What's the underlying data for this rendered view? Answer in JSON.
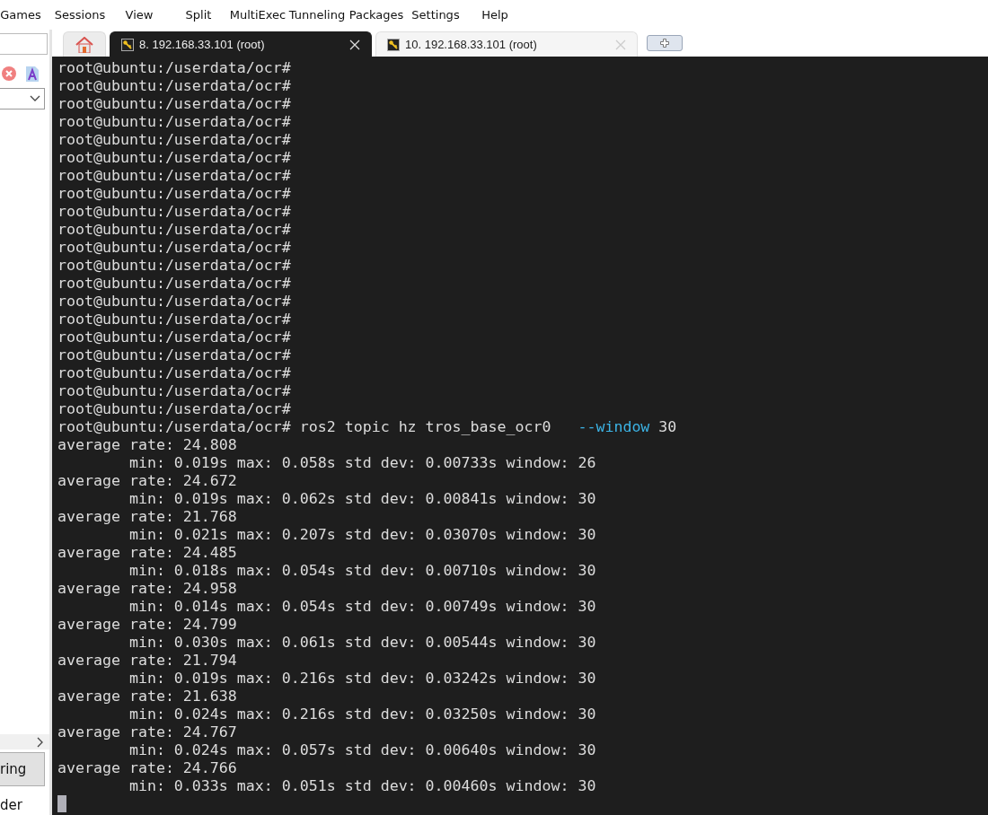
{
  "menu": [
    "Games",
    "Sessions",
    "View",
    "Split",
    "MultiExec",
    "Tunneling",
    "Packages",
    "Settings",
    "Help"
  ],
  "sidebar": {
    "button": "ring",
    "text": "der"
  },
  "tabs": [
    {
      "kind": "home",
      "selected": false
    },
    {
      "kind": "session",
      "label": "8. 192.168.33.101 (root)",
      "selected": true
    },
    {
      "kind": "session",
      "label": "10. 192.168.33.101 (root)",
      "selected": false
    },
    {
      "kind": "new",
      "selected": false
    }
  ],
  "terminal": {
    "lines": [
      {
        "kind": "prompt",
        "text": "root@ubuntu:/userdata/ocr#"
      },
      {
        "kind": "prompt",
        "text": "root@ubuntu:/userdata/ocr#"
      },
      {
        "kind": "prompt",
        "text": "root@ubuntu:/userdata/ocr#"
      },
      {
        "kind": "prompt",
        "text": "root@ubuntu:/userdata/ocr#"
      },
      {
        "kind": "prompt",
        "text": "root@ubuntu:/userdata/ocr#"
      },
      {
        "kind": "prompt",
        "text": "root@ubuntu:/userdata/ocr#"
      },
      {
        "kind": "prompt",
        "text": "root@ubuntu:/userdata/ocr#"
      },
      {
        "kind": "prompt",
        "text": "root@ubuntu:/userdata/ocr#"
      },
      {
        "kind": "prompt",
        "text": "root@ubuntu:/userdata/ocr#"
      },
      {
        "kind": "prompt",
        "text": "root@ubuntu:/userdata/ocr#"
      },
      {
        "kind": "prompt",
        "text": "root@ubuntu:/userdata/ocr#"
      },
      {
        "kind": "prompt",
        "text": "root@ubuntu:/userdata/ocr#"
      },
      {
        "kind": "prompt",
        "text": "root@ubuntu:/userdata/ocr#"
      },
      {
        "kind": "prompt",
        "text": "root@ubuntu:/userdata/ocr#"
      },
      {
        "kind": "prompt",
        "text": "root@ubuntu:/userdata/ocr#"
      },
      {
        "kind": "prompt",
        "text": "root@ubuntu:/userdata/ocr#"
      },
      {
        "kind": "prompt",
        "text": "root@ubuntu:/userdata/ocr#"
      },
      {
        "kind": "prompt",
        "text": "root@ubuntu:/userdata/ocr#"
      },
      {
        "kind": "prompt",
        "text": "root@ubuntu:/userdata/ocr#"
      },
      {
        "kind": "prompt",
        "text": "root@ubuntu:/userdata/ocr#"
      },
      {
        "kind": "command",
        "prompt": "root@ubuntu:/userdata/ocr#",
        "command": "ros2 topic hz tros_base_ocr0",
        "option": "--window",
        "value": "30"
      },
      {
        "kind": "output",
        "text": "average rate: 24.808"
      },
      {
        "kind": "output",
        "text": "        min: 0.019s max: 0.058s std dev: 0.00733s window: 26"
      },
      {
        "kind": "output",
        "text": "average rate: 24.672"
      },
      {
        "kind": "output",
        "text": "        min: 0.019s max: 0.062s std dev: 0.00841s window: 30"
      },
      {
        "kind": "output",
        "text": "average rate: 21.768"
      },
      {
        "kind": "output",
        "text": "        min: 0.021s max: 0.207s std dev: 0.03070s window: 30"
      },
      {
        "kind": "output",
        "text": "average rate: 24.485"
      },
      {
        "kind": "output",
        "text": "        min: 0.018s max: 0.054s std dev: 0.00710s window: 30"
      },
      {
        "kind": "output",
        "text": "average rate: 24.958"
      },
      {
        "kind": "output",
        "text": "        min: 0.014s max: 0.054s std dev: 0.00749s window: 30"
      },
      {
        "kind": "output",
        "text": "average rate: 24.799"
      },
      {
        "kind": "output",
        "text": "        min: 0.030s max: 0.061s std dev: 0.00544s window: 30"
      },
      {
        "kind": "output",
        "text": "average rate: 21.794"
      },
      {
        "kind": "output",
        "text": "        min: 0.019s max: 0.216s std dev: 0.03242s window: 30"
      },
      {
        "kind": "output",
        "text": "average rate: 21.638"
      },
      {
        "kind": "output",
        "text": "        min: 0.024s max: 0.216s std dev: 0.03250s window: 30"
      },
      {
        "kind": "output",
        "text": "average rate: 24.767"
      },
      {
        "kind": "output",
        "text": "        min: 0.024s max: 0.057s std dev: 0.00640s window: 30"
      },
      {
        "kind": "output",
        "text": "average rate: 24.766"
      },
      {
        "kind": "output",
        "text": "        min: 0.033s max: 0.051s std dev: 0.00460s window: 30"
      }
    ]
  }
}
